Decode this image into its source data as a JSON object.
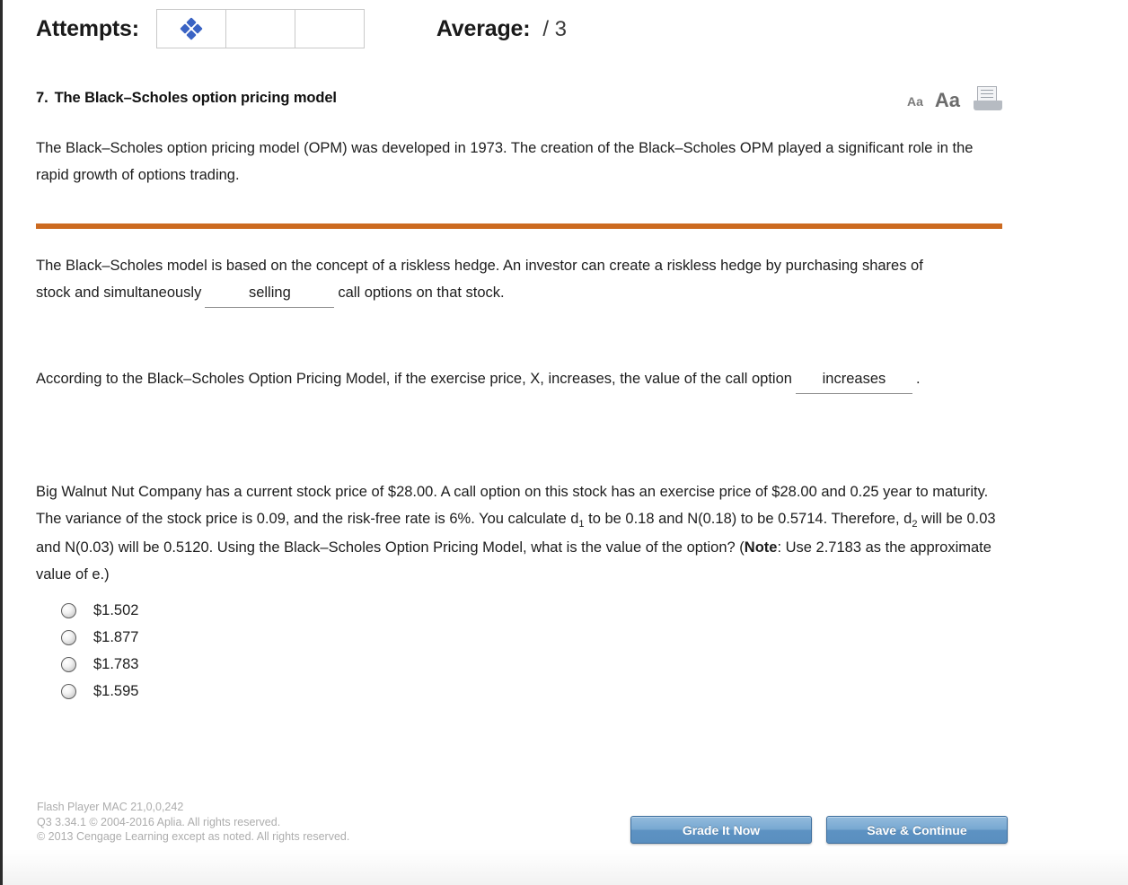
{
  "header": {
    "attempts_label": "Attempts:",
    "attempt_boxes": [
      {
        "icon": "diamond-cluster-icon",
        "filled": true
      },
      {
        "icon": "",
        "filled": false
      },
      {
        "icon": "",
        "filled": false
      }
    ],
    "average_label": "Average:",
    "average_value": "/ 3",
    "accent_color": "#3a63c4"
  },
  "question": {
    "number": "7.",
    "title": "The Black–Scholes option pricing model",
    "tools": [
      {
        "name": "decrease-font-size-icon",
        "label": "Aa"
      },
      {
        "name": "increase-font-size-icon",
        "label": "Aa"
      },
      {
        "name": "print-icon",
        "label": ""
      }
    ]
  },
  "content": {
    "intro_paragraph": "The Black–Scholes option pricing model (OPM) was developed in 1973. The creation of the Black–Scholes OPM played a significant role in the rapid growth of options trading.",
    "divider_color": "#cc6a20",
    "hedge_text_before": "The Black–Scholes model is based on the concept of a riskless hedge. An investor can create a riskless hedge by purchasing shares of stock and simultaneously",
    "hedge_blank_value": "selling",
    "hedge_text_after": "call options on that stock.",
    "exercise_text_before": "According to the Black–Scholes Option Pricing Model, if the exercise price, X, increases, the value of the call option",
    "exercise_blank_value": "increases",
    "exercise_text_after": ".",
    "problem_part1": "Big Walnut Nut Company has a current stock price of $28.00. A call option on this stock has an exercise price of $28.00 and 0.25 year to maturity. The variance of the stock price is 0.09, and the risk-free rate is 6%. You calculate d",
    "problem_sub1": "1",
    "problem_part2": " to be 0.18 and N(0.18) to be 0.5714. Therefore, d",
    "problem_sub2": "2",
    "problem_part3": " will be 0.03 and N(0.03) will be 0.5120. Using the Black–Scholes Option Pricing Model, what is the value of the option? (",
    "problem_note_bold": "Note",
    "problem_part4": ": Use 2.7183 as the approximate value of e.)"
  },
  "choices": [
    {
      "label": "$1.502",
      "selected": false
    },
    {
      "label": "$1.877",
      "selected": false
    },
    {
      "label": "$1.783",
      "selected": false
    },
    {
      "label": "$1.595",
      "selected": false
    }
  ],
  "footer": {
    "line1": "Flash Player MAC 21,0,0,242",
    "line2": "Q3 3.34.1 © 2004-2016 Aplia. All rights reserved.",
    "line3": "© 2013 Cengage Learning except as noted. All rights reserved.",
    "grade_button": "Grade It Now",
    "save_button": "Save & Continue",
    "button_color": "#5d92c2"
  }
}
